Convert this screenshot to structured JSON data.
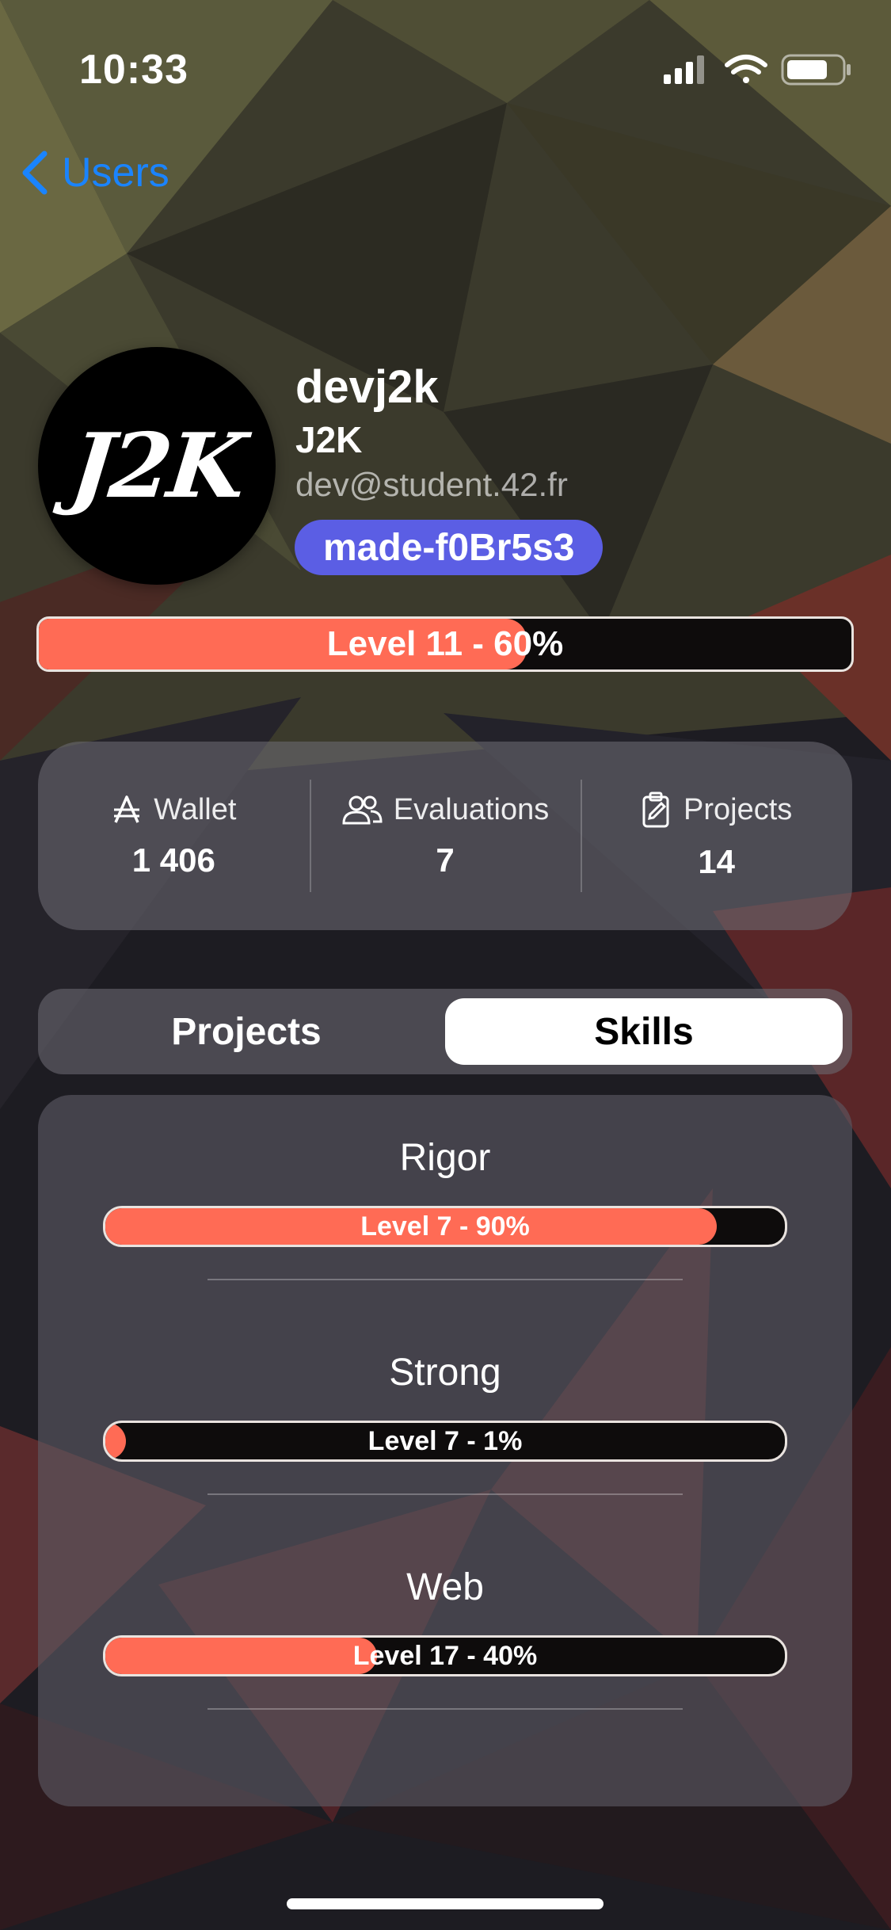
{
  "status_bar": {
    "time": "10:33",
    "icons": [
      "cellular-signal-icon",
      "wifi-icon",
      "battery-icon"
    ]
  },
  "nav": {
    "back_label": "Users"
  },
  "profile": {
    "avatar_text": "J2K",
    "login": "devj2k",
    "display_name": "J2K",
    "email": "dev@student.42.fr",
    "coalition": "made-f0Br5s3",
    "coalition_color": "#5b5ee4",
    "level_label": "Level 11 - 60%",
    "level_progress": 0.6
  },
  "stats": [
    {
      "icon": "currency-icon",
      "label": "Wallet",
      "value": "1 406"
    },
    {
      "icon": "people-icon",
      "label": "Evaluations",
      "value": "7"
    },
    {
      "icon": "clipboard-icon",
      "label": "Projects",
      "value": "14"
    }
  ],
  "tabs": [
    {
      "label": "Projects",
      "active": false
    },
    {
      "label": "Skills",
      "active": true
    }
  ],
  "skills": [
    {
      "name": "Rigor",
      "label": "Level 7 - 90%",
      "progress": 0.9
    },
    {
      "name": "Strong",
      "label": "Level 7 - 1%",
      "progress": 0.01
    },
    {
      "name": "Web",
      "label": "Level 17 - 40%",
      "progress": 0.4
    }
  ],
  "colors": {
    "accent_link": "#1a84ff",
    "progress_fill": "#ff6b55",
    "progress_track": "#0e0c0c"
  }
}
